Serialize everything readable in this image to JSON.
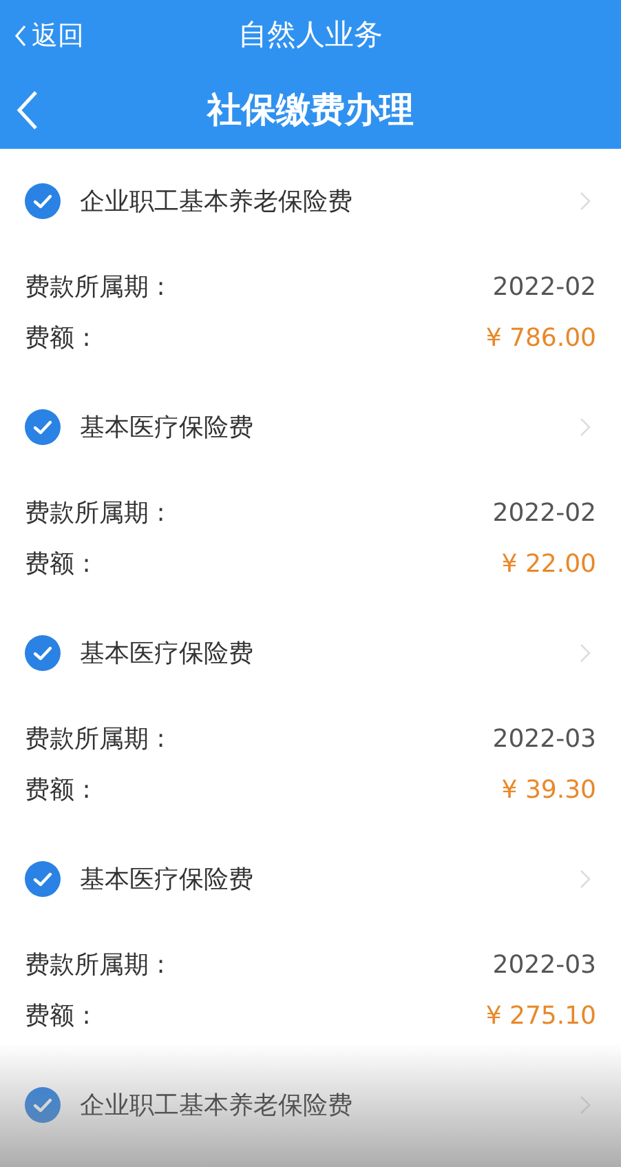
{
  "status_bar": {
    "back": "返回",
    "title": "自然人业务"
  },
  "header": {
    "title": "社保缴费办理"
  },
  "items": [
    {
      "name": "企业职工基本养老保险费",
      "checked": true,
      "period_label": "费款所属期 :",
      "period": "2022-02",
      "amount_label": "费额 :",
      "amount": "¥ 786.00"
    },
    {
      "name": "基本医疗保险费",
      "checked": true,
      "period_label": "费款所属期 :",
      "period": "2022-02",
      "amount_label": "费额 :",
      "amount": "¥ 22.00"
    },
    {
      "name": "基本医疗保险费",
      "checked": true,
      "period_label": "费款所属期 :",
      "period": "2022-03",
      "amount_label": "费额 :",
      "amount": "¥ 39.30"
    },
    {
      "name": "基本医疗保险费",
      "checked": true,
      "period_label": "费款所属期 :",
      "period": "2022-03",
      "amount_label": "费额 :",
      "amount": "¥ 275.10"
    },
    {
      "name": "企业职工基本养老保险费",
      "checked": true
    }
  ]
}
